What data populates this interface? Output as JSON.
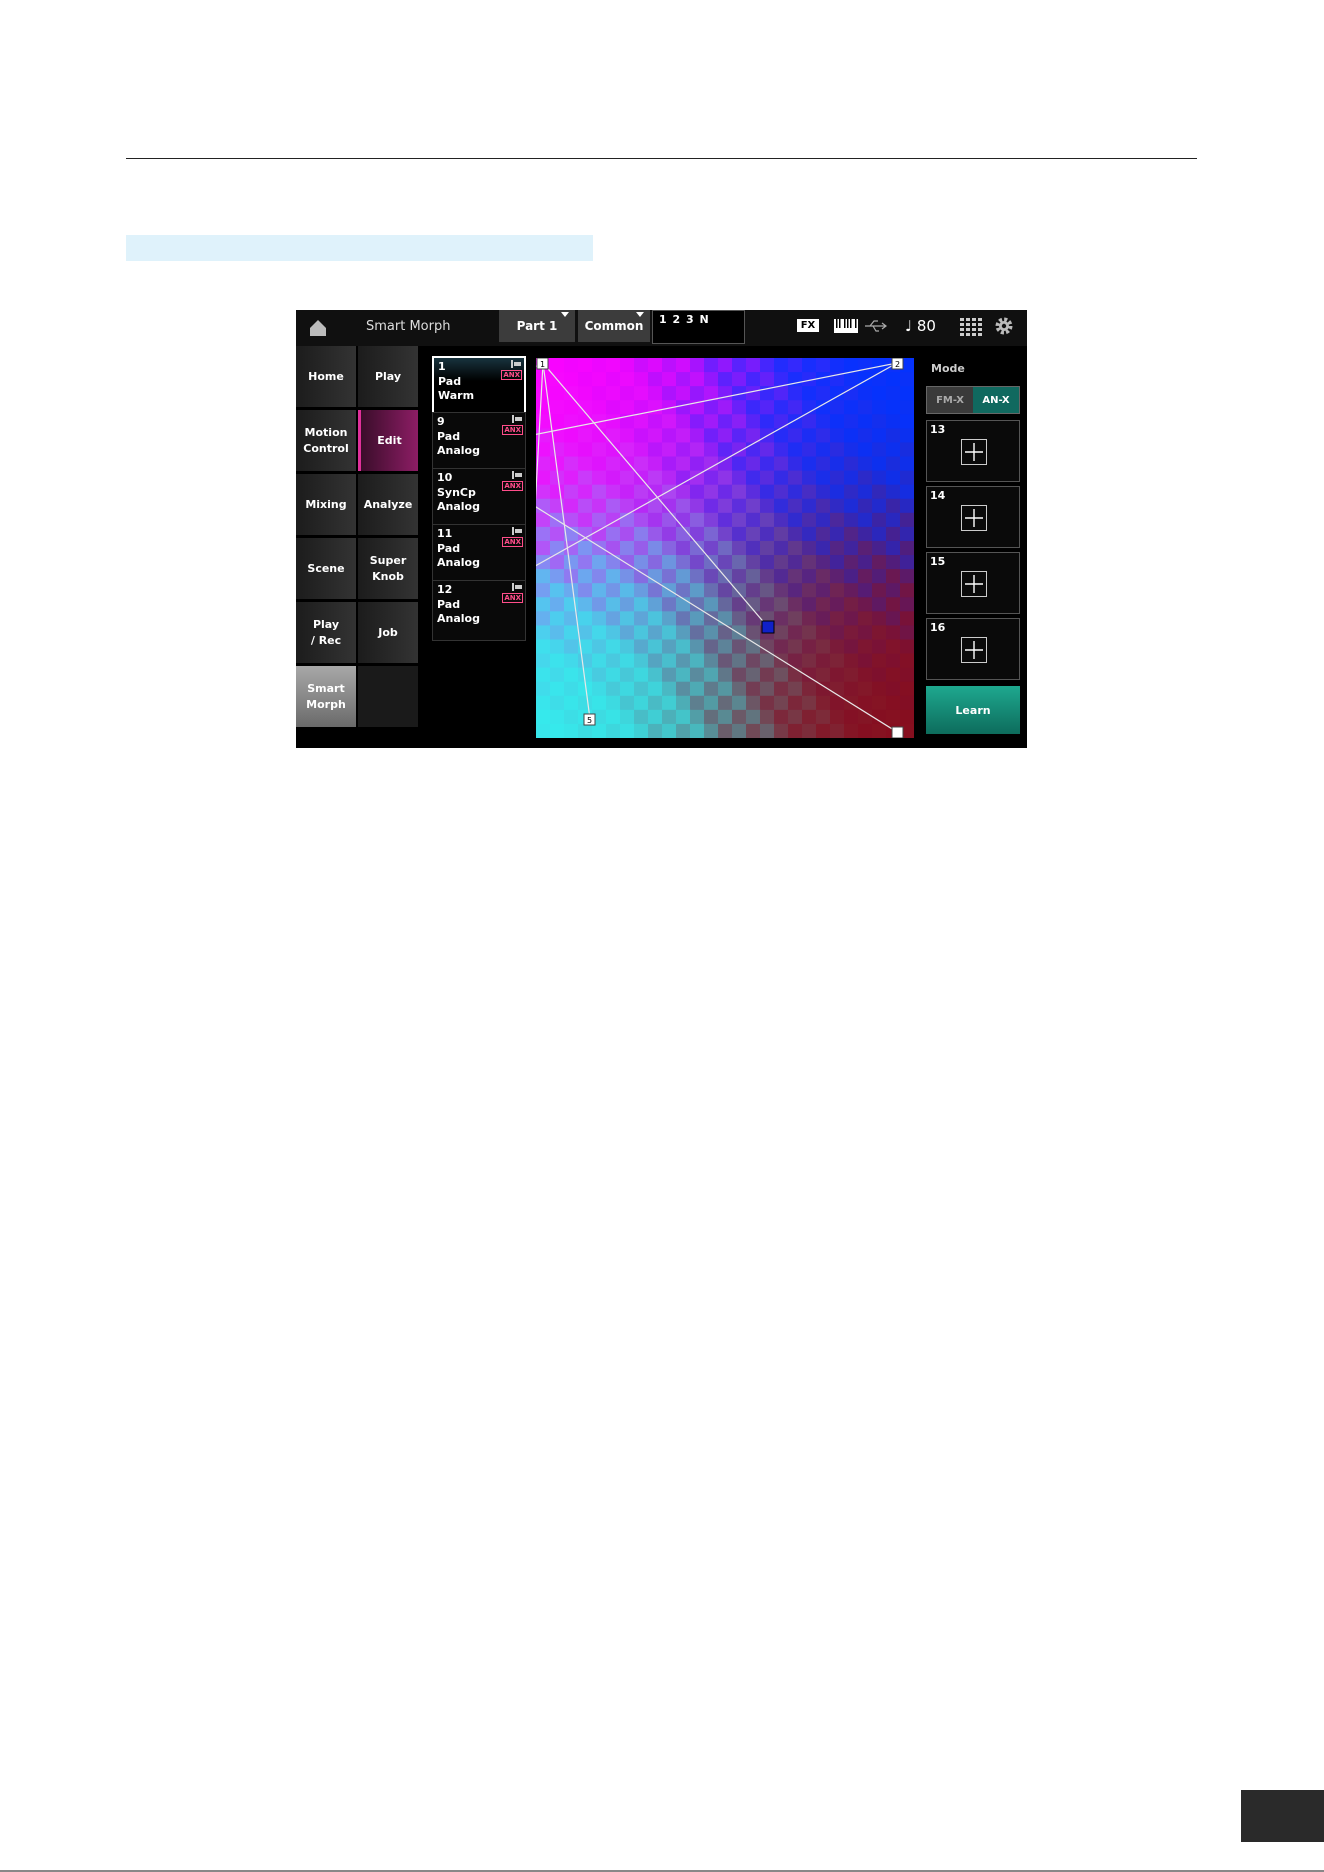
{
  "screen": {
    "title": "Smart Morph",
    "part_button": "Part 1",
    "common_button": "Common",
    "name_box": "1 2 3 N",
    "fx_label": "FX",
    "tempo": "♩ 80",
    "icons": [
      "home-icon",
      "keyboard-icon",
      "usb-icon",
      "grid-icon",
      "gear-icon"
    ]
  },
  "nav_left": [
    "Home",
    "Motion\nControl",
    "Mixing",
    "Scene",
    "Play\n/ Rec",
    "Smart\nMorph"
  ],
  "nav_right": [
    "Play",
    "Edit",
    "Analyze",
    "Super Knob",
    "Job",
    ""
  ],
  "parts": [
    {
      "num": "1",
      "name": "Pad\nWarm",
      "badge": "ANX",
      "selected": true
    },
    {
      "num": "9",
      "name": "Pad\nAnalog",
      "badge": "ANX",
      "selected": false
    },
    {
      "num": "10",
      "name": "SynCp\nAnalog",
      "badge": "ANX",
      "selected": false
    },
    {
      "num": "11",
      "name": "Pad\nAnalog",
      "badge": "ANX",
      "selected": false
    },
    {
      "num": "12",
      "name": "Pad\nAnalog",
      "badge": "ANX",
      "selected": false
    }
  ],
  "map": {
    "markers": [
      "1",
      "2",
      "",
      "5"
    ],
    "colors": {
      "top_left": "#ff00ff",
      "top_right": "#0033ff",
      "bottom_left": "#33eeee",
      "bottom_right": "#8a0a18"
    }
  },
  "mode": {
    "label": "Mode",
    "options": [
      "FM-X",
      "AN-X"
    ],
    "selected": "AN-X"
  },
  "slots": [
    "13",
    "14",
    "15",
    "16"
  ],
  "learn_button": "Learn"
}
